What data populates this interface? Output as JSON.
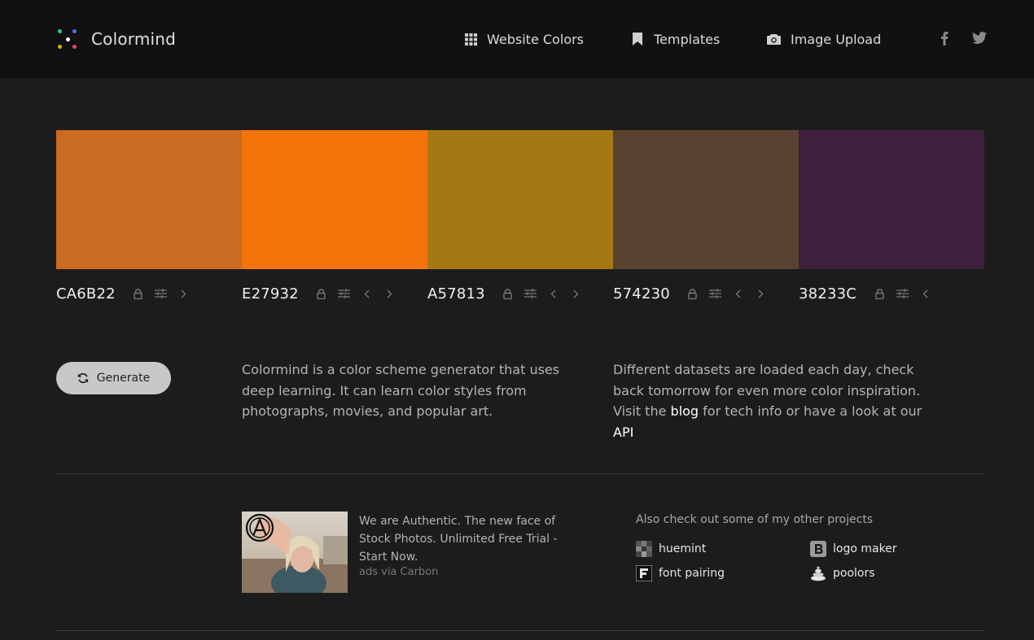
{
  "app": {
    "name": "Colormind"
  },
  "nav": [
    {
      "label": "Website Colors",
      "icon": "grid-icon"
    },
    {
      "label": "Templates",
      "icon": "bookmark-icon"
    },
    {
      "label": "Image Upload",
      "icon": "camera-icon"
    }
  ],
  "social": [
    {
      "icon": "facebook-icon"
    },
    {
      "icon": "twitter-icon"
    }
  ],
  "palette": [
    {
      "hex": "CA6B22",
      "color": "#CA6B22",
      "prev": false,
      "next": true
    },
    {
      "hex": "E27932",
      "color": "#F2740A",
      "prev": true,
      "next": true
    },
    {
      "hex": "A57813",
      "color": "#A57813",
      "prev": true,
      "next": true
    },
    {
      "hex": "574230",
      "color": "#5A4232",
      "prev": true,
      "next": true
    },
    {
      "hex": "38233C",
      "color": "#3E1F3C",
      "prev": true,
      "next": false
    }
  ],
  "generate": {
    "label": "Generate"
  },
  "about": {
    "text": "Colormind is a color scheme generator that uses deep learning. It can learn color styles from photographs, movies, and popular art.",
    "datasets_before": "Different datasets are loaded each day, check back tomorrow for even more color inspiration. Visit the ",
    "blog_link": "blog",
    "datasets_middle": " for tech info or have a look at our ",
    "api_link": "API"
  },
  "ad": {
    "text": "We are Authentic. The new face of Stock Photos. Unlimited Free Trial - Start Now.",
    "via": "ads via Carbon"
  },
  "projects": {
    "heading": "Also check out some of my other projects",
    "items": [
      {
        "label": "huemint",
        "icon": "huemint-icon"
      },
      {
        "label": "logo maker",
        "icon": "logo-maker-icon"
      },
      {
        "label": "font pairing",
        "icon": "font-pairing-icon"
      },
      {
        "label": "poolors",
        "icon": "poolors-icon"
      }
    ]
  },
  "colors": {
    "header_bg": "#111111",
    "page_bg": "#1c1c1c",
    "button_bg": "#c8c8c8"
  }
}
